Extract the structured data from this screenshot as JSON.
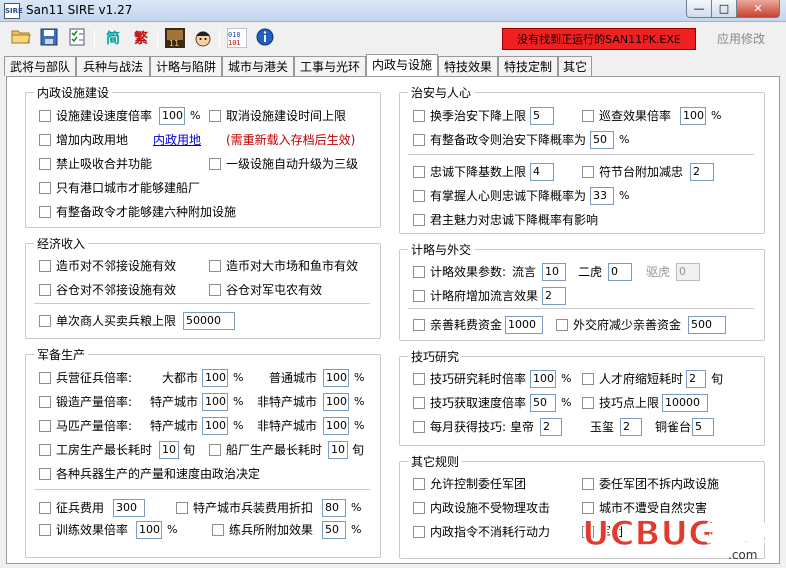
{
  "window": {
    "title": "San11 SIRE v1.27",
    "app_icon_text": "SIRE",
    "min": "—",
    "max": "□",
    "close": "✕"
  },
  "toolbar": {
    "jian": "简",
    "fan": "繁",
    "badge11": "11",
    "status": "没有找到正运行的SAN11PK.EXE",
    "apply": "应用修改"
  },
  "tabs": [
    "武将与部队",
    "兵种与战法",
    "计略与陷阱",
    "城市与港关",
    "工事与光环",
    "内政与设施",
    "特技效果",
    "特技定制",
    "其它"
  ],
  "active_tab": 5,
  "g1": {
    "title": "内政设施建设",
    "build_speed": "设施建设速度倍率",
    "build_speed_val": "100",
    "build_speed_unit": "%",
    "cancel_time": "取消设施建设时间上限",
    "add_land": "增加内政用地",
    "land_link": "内政用地",
    "reload_note": "(需重新载入存档后生效)",
    "no_merge": "禁止吸收合并功能",
    "auto_upgrade": "一级设施自动升级为三级",
    "port_ship": "只有港口城市才能够建船厂",
    "six_fac": "有整备政令才能够建六种附加设施"
  },
  "g2": {
    "title": "经济收入",
    "coin_non_adj": "造币对不邻接设施有效",
    "coin_market": "造币对大市场和鱼市有效",
    "granary_non_adj": "谷仓对不邻接设施有效",
    "granary_farm": "谷仓对军屯农有效",
    "merchant": "单次商人买卖兵粮上限",
    "merchant_val": "50000"
  },
  "g3": {
    "title": "军备生产",
    "recruit": "兵营征兵倍率:",
    "big_city": "大都市",
    "normal_city": "普通城市",
    "forge": "锻造产量倍率:",
    "special_city": "特产城市",
    "non_special": "非特产城市",
    "stable": "马匹产量倍率:",
    "special_city2": "特产城市",
    "non_special2": "非特产城市",
    "recruit_a": "100",
    "recruit_b": "100",
    "forge_a": "100",
    "forge_b": "100",
    "stable_a": "100",
    "stable_b": "100",
    "pct": "%",
    "workshop": "工房生产最长耗时",
    "workshop_val": "10",
    "xun": "旬",
    "dock": "船厂生产最长耗时",
    "dock_val": "10",
    "xun2": "旬",
    "weapon_note": "各种兵器生产的产量和速度由政治决定",
    "conscript_fee": "征兵费用",
    "conscript_fee_val": "300",
    "special_discount": "特产城市兵装费用折扣",
    "special_discount_val": "80",
    "train_eff": "训练效果倍率",
    "train_eff_val": "100",
    "train_add": "练兵所附加效果",
    "train_add_val": "50"
  },
  "g4": {
    "title": "治安与人心",
    "order_limit": "换季治安下降上限",
    "order_limit_val": "5",
    "patrol": "巡查效果倍率",
    "patrol_val": "100",
    "order_prob": "有整备政令则治安下降概率为",
    "order_prob_val": "50",
    "loyal_base": "忠诚下降基数上限",
    "loyal_base_val": "4",
    "festival": "符节台附加减忠",
    "festival_val": "2",
    "loyal_prob": "有掌握人心则忠诚下降概率为",
    "loyal_prob_val": "33",
    "charm": "君主魅力对忠诚下降概率有影响"
  },
  "g5": {
    "title": "计略与外交",
    "scheme_params": "计略效果参数:",
    "rumor": "流言",
    "rumor_val": "10",
    "two_tigers": "二虎",
    "two_tigers_val": "0",
    "drive_tiger": "驱虎",
    "drive_tiger_val": "0",
    "scheme_office": "计略府增加流言效果",
    "scheme_office_val": "2",
    "goodwill": "亲善耗费资金",
    "goodwill_val": "1000",
    "diplomacy": "外交府减少亲善资金",
    "diplomacy_val": "500"
  },
  "g6": {
    "title": "技巧研究",
    "research_time": "技巧研究耗时倍率",
    "research_time_val": "100",
    "talent": "人才府缩短耗时",
    "talent_val": "2",
    "talent_unit": "旬",
    "gain_speed": "技巧获取速度倍率",
    "gain_speed_val": "50",
    "point_cap": "技巧点上限",
    "point_cap_val": "10000",
    "monthly": "每月获得技巧:",
    "emperor": "皇帝",
    "emperor_val": "2",
    "seal": "玉玺",
    "seal_val": "2",
    "bronze": "铜雀台",
    "bronze_val": "5"
  },
  "g7": {
    "title": "其它规则",
    "delegate": "允许控制委任军团",
    "no_demolish": "委任军团不拆内政设施",
    "no_physical": "内政设施不受物理攻击",
    "no_disaster": "城市不遭受自然灾害",
    "no_stamina": "内政指令不消耗行动力",
    "troop_prefix": "军团"
  },
  "watermark": {
    "logo": "UCBUG",
    "text": "游戏网",
    "url": ".com"
  }
}
